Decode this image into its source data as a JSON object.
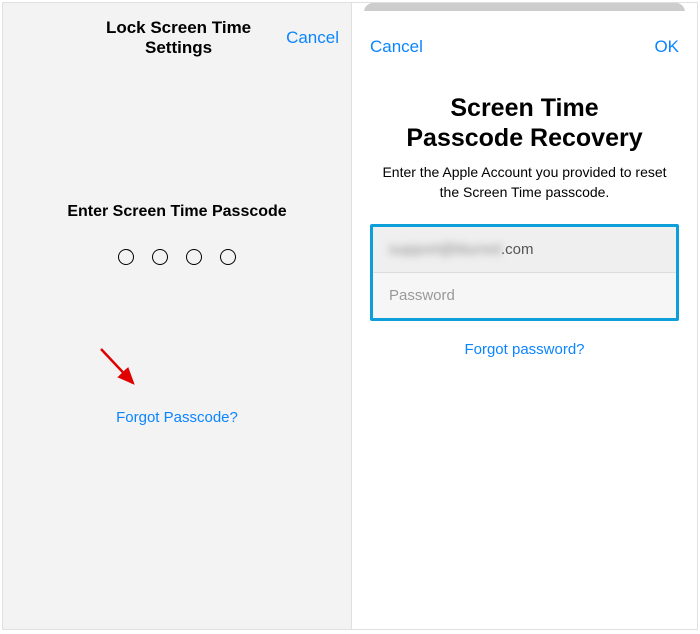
{
  "left": {
    "title": "Lock Screen Time Settings",
    "cancel": "Cancel",
    "enter_label": "Enter Screen Time Passcode",
    "forgot_link": "Forgot Passcode?"
  },
  "right": {
    "cancel": "Cancel",
    "ok": "OK",
    "title_line1": "Screen Time",
    "title_line2": "Passcode Recovery",
    "subtitle": "Enter the Apple Account you provided to reset the Screen Time passcode.",
    "email_obscured": "support@blurred",
    "email_suffix": ".com",
    "password_placeholder": "Password",
    "forgot_link": "Forgot password?"
  }
}
